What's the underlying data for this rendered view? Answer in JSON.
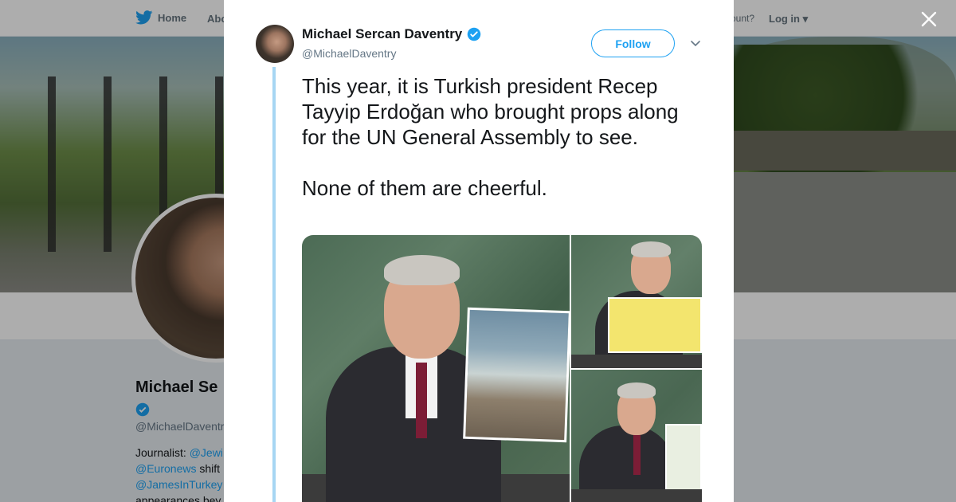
{
  "background": {
    "nav": {
      "home_label": "Home",
      "about_label": "Abo",
      "account_text": "ccount?",
      "login_label": "Log in"
    },
    "profile": {
      "name": "Michael Se",
      "handle": "@MichaelDaventr",
      "bio_prefix": "Journalist: ",
      "bio_link_1": "@Jewi",
      "bio_link_2": "@Euronews",
      "bio_mid": " shift",
      "bio_link_3": "@JamesInTurkey",
      "bio_tail": "appearances bey"
    }
  },
  "tweet": {
    "author_name": "Michael Sercan Daventry",
    "author_handle": "@MichaelDaventry",
    "follow_label": "Follow",
    "text_paragraph_1": "This year, it is Turkish president Recep Tayyip Erdoğan who brought props along for the UN General Assembly to see.",
    "text_paragraph_2": "None of them are cheerful.",
    "colors": {
      "accent": "#1da1f2",
      "thread_line": "#a6d6f3",
      "text": "#14171a",
      "secondary_text": "#657786"
    },
    "media_count": 3
  },
  "icons": {
    "close": "close-icon",
    "verified": "verified-badge-icon",
    "caret": "chevron-down-icon",
    "bird": "twitter-bird-icon"
  }
}
